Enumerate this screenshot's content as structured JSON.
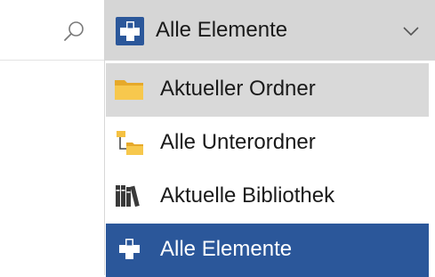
{
  "search": {
    "icon": "search-icon"
  },
  "scope": {
    "selected_label": "Alle Elemente",
    "icon": "all-items-icon",
    "chevron": "chevron-down-icon"
  },
  "dropdown": {
    "options": [
      {
        "label": "Aktueller Ordner",
        "icon": "folder-icon",
        "state": "hover"
      },
      {
        "label": "Alle Unterordner",
        "icon": "subfolders-icon",
        "state": "normal"
      },
      {
        "label": "Aktuelle Bibliothek",
        "icon": "library-icon",
        "state": "normal"
      },
      {
        "label": "Alle Elemente",
        "icon": "all-items-icon",
        "state": "selected"
      }
    ]
  },
  "colors": {
    "selected_bg": "#2b579a",
    "hover_bg": "#d9d9d9",
    "combobox_bg": "#d6d6d6",
    "icon_blue": "#2b579a",
    "folder_yellow": "#f5c142"
  }
}
